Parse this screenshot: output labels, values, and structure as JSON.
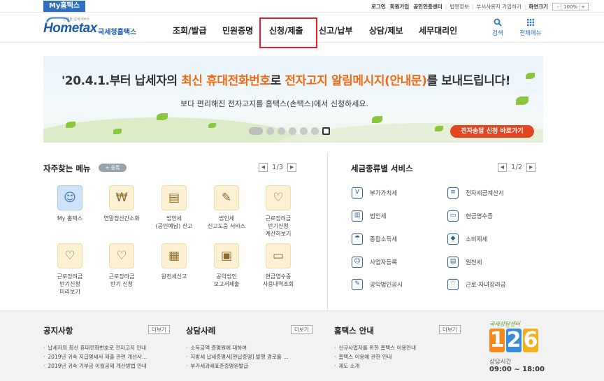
{
  "topbar": {
    "my_hometax": "My홈택스",
    "links": [
      "로그인",
      "회원가입",
      "공인인증센터",
      "법령정보",
      "부서사용자 가입하기",
      "화면크기"
    ],
    "zoom_value": "100%",
    "zoom_minus": "-",
    "zoom_plus": "+"
  },
  "logo": {
    "brand": "Hometax",
    "org": "국세청홈택스",
    "tagline": "언제든 납세서비스"
  },
  "nav": {
    "items": [
      "조회/발급",
      "민원증명",
      "신청/제출",
      "신고/납부",
      "상담/제보",
      "세무대리인"
    ],
    "highlighted_index": 2,
    "search_label": "검색",
    "menu_label": "전체메뉴"
  },
  "banner": {
    "title_prefix": "'20.4.1.부터 납세자의 ",
    "title_highlight1": "최신 휴대전화번호",
    "title_mid": "로 ",
    "title_highlight2": "전자고지 알림메시지(안내문)",
    "title_suffix": "를 보내드립니다!",
    "subtitle": "보다 편리해진 전자고지를 홈택스(손택스)에서 신청하세요.",
    "cta": "전자송달 신청 바로가기",
    "slide_count": 7,
    "active_slide": 7
  },
  "favorites": {
    "title": "자주찾는 메뉴",
    "add_label": "+ 등록",
    "page": "1/3",
    "items": [
      {
        "label": "My 홈택스",
        "icon": "person-icon"
      },
      {
        "label": "연말정산간소화",
        "icon": "money-bag-icon"
      },
      {
        "label": "법인세\n(공인예납) 신고",
        "icon": "building-doc-icon"
      },
      {
        "label": "법인세\n신고도움 서비스",
        "icon": "doc-help-icon"
      },
      {
        "label": "근로장려금\n반기신청\n계산하보기",
        "icon": "heart-card-icon"
      },
      {
        "label": "근로장려금\n반기신청\n미리보기",
        "icon": "heart-hand-icon"
      },
      {
        "label": "근로장려금\n반기 신청",
        "icon": "heart-hand-icon"
      },
      {
        "label": "원천세신고",
        "icon": "calendar-icon"
      },
      {
        "label": "공익법인\n보고서제출",
        "icon": "report-icon"
      },
      {
        "label": "현금영수증\n사용내역조회",
        "icon": "receipt-icon"
      }
    ]
  },
  "tax_services": {
    "title": "세금종류별 서비스",
    "page": "1/2",
    "items": [
      {
        "label": "부가가치세",
        "icon": "vat-icon"
      },
      {
        "label": "전자세금계산서",
        "icon": "invoice-icon"
      },
      {
        "label": "법인세",
        "icon": "corporation-icon"
      },
      {
        "label": "현금영수증",
        "icon": "cash-receipt-icon"
      },
      {
        "label": "종합소득세",
        "icon": "income-icon"
      },
      {
        "label": "소비제세",
        "icon": "diamond-icon"
      },
      {
        "label": "사업자등록",
        "icon": "person-icon"
      },
      {
        "label": "원천세",
        "icon": "withholding-icon"
      },
      {
        "label": "공익법인공시",
        "icon": "disclosure-icon"
      },
      {
        "label": "근로·자녀장려금",
        "icon": "heart-icon"
      }
    ]
  },
  "footer": {
    "more_label": "더보기",
    "notice": {
      "title": "공지사항",
      "items": [
        "납세자의 최신 휴대전화번호로 전자고지 안내",
        "2019년 귀속 지급명세서 제출 관련 개선사…",
        "2019년 귀속 기부금 이월공제 계산방법 안내"
      ]
    },
    "consult": {
      "title": "상담사례",
      "items": [
        "소득금액 증명원에 대하여",
        "지방세 납세증명서[완납증명] 발행 경로를 …",
        "부가세과세표준증명원발급"
      ]
    },
    "guide": {
      "title": "홈택스 안내",
      "items": [
        "신규사업자를 위한 홈택스 이용안내",
        "홈택스 이용에 관한 안내",
        "제도 소개"
      ]
    },
    "callcenter": {
      "small": "국세상담센터",
      "digits": [
        "1",
        "2",
        "6"
      ],
      "hours_label": "상담시간",
      "hours": "09:00 ~ 18:00",
      "colors": [
        "#f28a1e",
        "#3a8bd6",
        "#f2b21e"
      ]
    }
  }
}
